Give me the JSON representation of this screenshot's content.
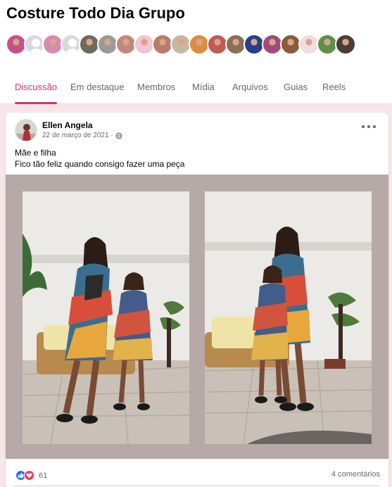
{
  "group": {
    "title": "Costure Todo Dia Grupo"
  },
  "members": [
    {
      "kind": "photo",
      "color": "#c8508a"
    },
    {
      "kind": "default",
      "color": "#d7dadf"
    },
    {
      "kind": "photo",
      "color": "#d98ab0"
    },
    {
      "kind": "default",
      "color": "#d7dadf"
    },
    {
      "kind": "photo",
      "color": "#6e6a5c"
    },
    {
      "kind": "photo",
      "color": "#9b9a96"
    },
    {
      "kind": "photo",
      "color": "#c2877a"
    },
    {
      "kind": "photo",
      "color": "#f4c3d6"
    },
    {
      "kind": "photo",
      "color": "#b77d6a"
    },
    {
      "kind": "photo",
      "color": "#c7b7a5"
    },
    {
      "kind": "photo",
      "color": "#d98f3f"
    },
    {
      "kind": "photo",
      "color": "#c05a55"
    },
    {
      "kind": "photo",
      "color": "#8a6e58"
    },
    {
      "kind": "photo",
      "color": "#27408b"
    },
    {
      "kind": "photo",
      "color": "#a34a7a"
    },
    {
      "kind": "photo",
      "color": "#8a5a3c"
    },
    {
      "kind": "photo",
      "color": "#f3dce4"
    },
    {
      "kind": "photo",
      "color": "#5f8f4a"
    },
    {
      "kind": "photo",
      "color": "#4a3c38"
    }
  ],
  "tabs": [
    {
      "label": "Discussão",
      "active": true
    },
    {
      "label": "Em destaque",
      "active": false
    },
    {
      "label": "Membros",
      "active": false
    },
    {
      "label": "Mídia",
      "active": false
    },
    {
      "label": "Arquivos",
      "active": false
    },
    {
      "label": "Guias",
      "active": false
    },
    {
      "label": "Reels",
      "active": false
    }
  ],
  "post": {
    "author": "Ellen Angela",
    "date": "22 de março de 2021",
    "separator": "·",
    "privacy_icon": "globe-icon",
    "text_line1": "Mãe e filha",
    "text_line2": "Fico tão feliz quando consigo fazer uma peça",
    "reaction_icons": [
      "like-icon",
      "love-icon"
    ],
    "reactions_count": "61",
    "comments": "4 comentários"
  },
  "colors": {
    "accent": "#d6336c",
    "page_bg": "#f7e6e8",
    "media_bg": "#b6a9a8",
    "like": "#1877f2",
    "love": "#f33e58"
  }
}
